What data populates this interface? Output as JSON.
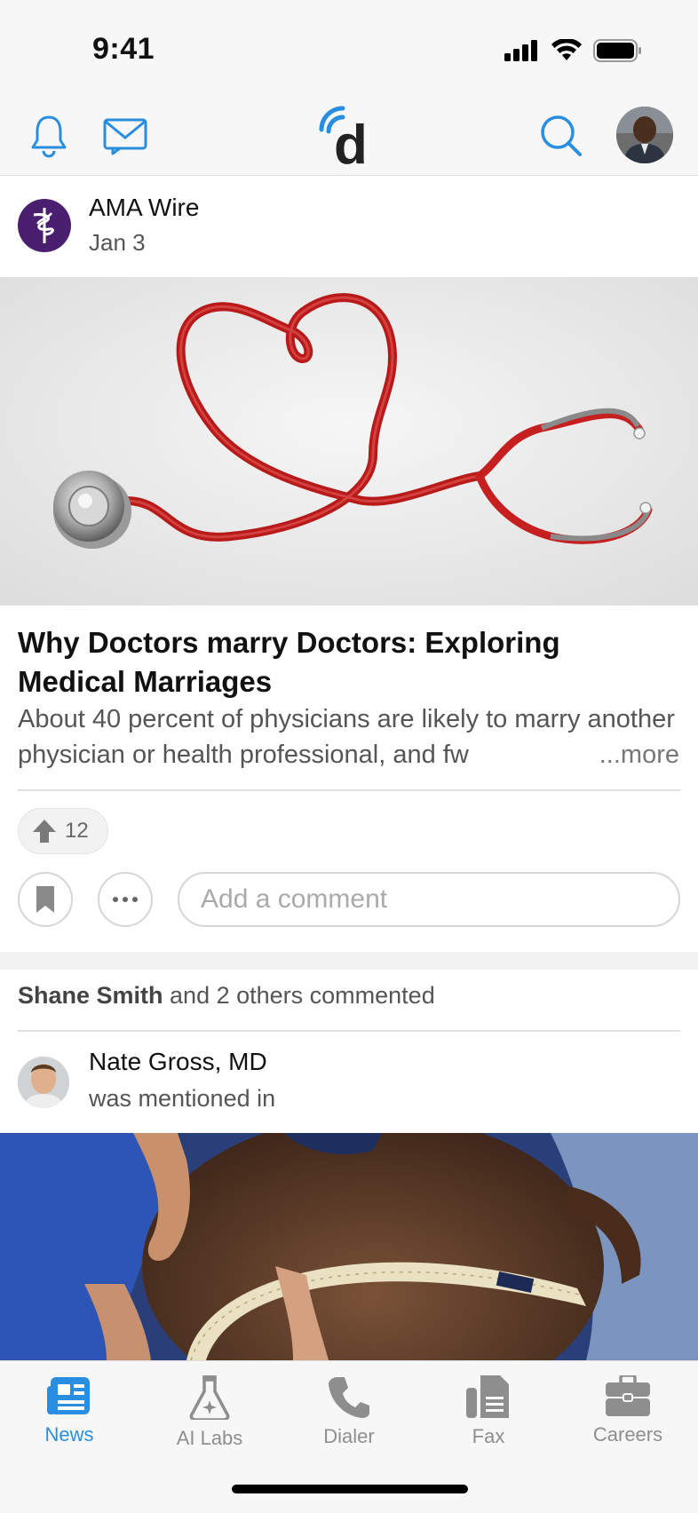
{
  "status_bar": {
    "time": "9:41"
  },
  "header": {
    "logo_letter": "d"
  },
  "post": {
    "source": "AMA Wire",
    "date": "Jan 3",
    "title": "Why Doctors marry Doctors: Exploring Medical Marriages",
    "excerpt": "About 40 percent of physicians are likely to marry another physician or health professional, and fw",
    "more_label": "...more",
    "upvotes": "12",
    "comment_placeholder": "Add a comment"
  },
  "activity": {
    "commenter": "Shane Smith",
    "commented_suffix": " and 2 others commented",
    "mention_name": "Nate Gross, MD",
    "mention_text": "was mentioned in"
  },
  "tabs": [
    {
      "label": "News",
      "icon": "newspaper-icon",
      "active": true
    },
    {
      "label": "AI Labs",
      "icon": "flask-icon",
      "active": false
    },
    {
      "label": "Dialer",
      "icon": "phone-icon",
      "active": false
    },
    {
      "label": "Fax",
      "icon": "fax-icon",
      "active": false
    },
    {
      "label": "Careers",
      "icon": "briefcase-icon",
      "active": false
    }
  ],
  "colors": {
    "accent": "#2a8ee0",
    "muted": "#8e8e8e",
    "ama_purple": "#4b1f6f"
  }
}
